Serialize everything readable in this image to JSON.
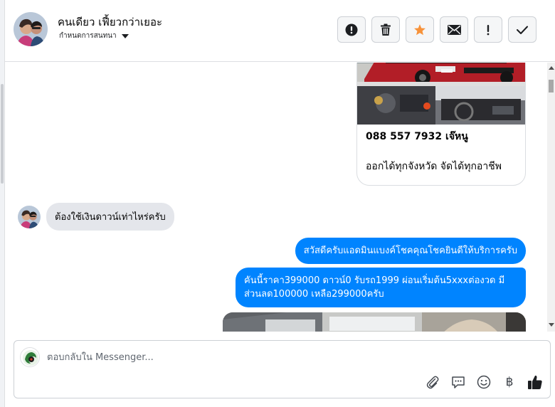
{
  "header": {
    "contact_name": "คนเดียว เฟี้ยวกว่าเยอะ",
    "subtitle": "กำหนดการสนทนา",
    "actions": [
      {
        "name": "report-spam-icon",
        "label": "!"
      },
      {
        "name": "trash-icon",
        "label": ""
      },
      {
        "name": "star-icon",
        "label": ""
      },
      {
        "name": "envelope-icon",
        "label": ""
      },
      {
        "name": "exclamation-icon",
        "label": "!"
      },
      {
        "name": "checkmark-icon",
        "label": ""
      }
    ],
    "colors": {
      "star": "#f7923a",
      "icon": "#1c1e21"
    }
  },
  "conversation": {
    "card": {
      "phone": "088 557 7932 เจ๊หนู",
      "description": "ออกได้ทุกจังหวัด จัดได้ทุกอาชีพ"
    },
    "incoming": [
      {
        "text": "ต้องใช้เงินดาวน์เท่าไหร่ครับ"
      }
    ],
    "outgoing": [
      {
        "text": "สวัสดีครับแอดมินแบงค์โชคคุณโชคยินดีให้บริการครับ"
      },
      {
        "text": "คันนี้ราคา399000 ดาวน์0 รับรถ1999 ผ่อนเริ่มต้น5xxxต่องวด มีส่วนลด100000 เหลือ299000ครับ"
      }
    ],
    "colors": {
      "outgoing_bubble": "#0084ff",
      "incoming_bubble": "#e4e6eb"
    }
  },
  "composer": {
    "placeholder": "ตอบกลับใน Messenger...",
    "baht_symbol": "฿",
    "tools": [
      "paperclip-icon",
      "chat-bubble-icon",
      "smiley-icon",
      "baht-icon",
      "thumbs-up-icon"
    ]
  }
}
